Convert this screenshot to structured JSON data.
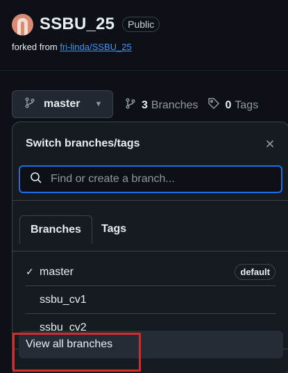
{
  "repo": {
    "name": "SSBU_25",
    "visibility": "Public",
    "forked_prefix": "forked from ",
    "forked_link": "fri-linda/SSBU_25"
  },
  "branch_button": {
    "label": "master"
  },
  "stats": {
    "branches_count": "3",
    "branches_label": "Branches",
    "tags_count": "0",
    "tags_label": "Tags"
  },
  "panel": {
    "title": "Switch branches/tags",
    "search_placeholder": "Find or create a branch...",
    "tabs": [
      {
        "label": "Branches"
      },
      {
        "label": "Tags"
      }
    ],
    "branches": [
      {
        "name": "master",
        "badge": "default"
      },
      {
        "name": "ssbu_cv1"
      },
      {
        "name": "ssbu_cv2"
      }
    ],
    "view_all": "View all branches"
  },
  "colors": {
    "accent_focus": "#1f6feb",
    "link": "#4493f8",
    "highlight": "#d52b2b"
  }
}
